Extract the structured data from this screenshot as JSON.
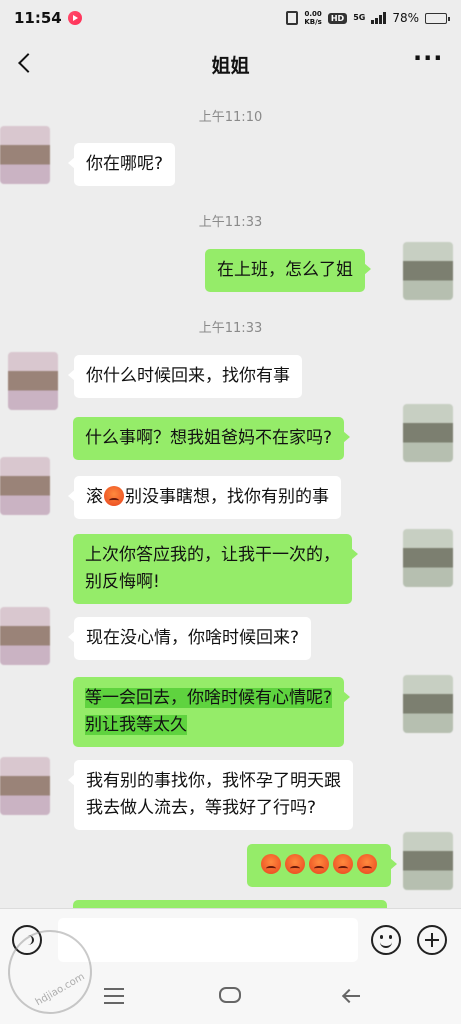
{
  "status_bar": {
    "time": "11:54",
    "net_speed_value": "0.00",
    "net_speed_unit": "KB/s",
    "hd_label": "HD",
    "network_type": "5G",
    "battery_percent": "78%",
    "battery_level": 0.78
  },
  "header": {
    "title": "姐姐"
  },
  "messages": [
    {
      "type": "time",
      "text": "上午11:10"
    },
    {
      "type": "in",
      "text": "你在哪呢?"
    },
    {
      "type": "time",
      "text": "上午11:33"
    },
    {
      "type": "out",
      "text": "在上班，怎么了姐"
    },
    {
      "type": "time",
      "text": "上午11:33"
    },
    {
      "type": "in",
      "text": "你什么时候回来，找你有事"
    },
    {
      "type": "out",
      "text": "什么事啊？想我姐爸妈不在家吗?"
    },
    {
      "type": "in",
      "text_before": "滚",
      "emoji": "angry-face-emoji",
      "text_after": "别没事瞎想，找你有别的事"
    },
    {
      "type": "out",
      "line1": "上次你答应我的，让我干一次的，",
      "line2": "别反悔啊!"
    },
    {
      "type": "in",
      "text": "现在没心情，你啥时候回来?"
    },
    {
      "type": "out",
      "line1": "等一会回去，你啥时候有心情呢?",
      "line2": "别让我等太久"
    },
    {
      "type": "in",
      "line1": "我有别的事找你，我怀孕了明天跟",
      "line2": "我去做人流去，等我好了行吗?"
    },
    {
      "type": "out",
      "emoji_count": 5,
      "emoji": "angry-face-emoji"
    }
  ],
  "input": {
    "placeholder": ""
  },
  "watermark": {
    "text": "hdjiao.com"
  },
  "colors": {
    "background": "#ededed",
    "incoming_bubble": "#ffffff",
    "outgoing_bubble": "#95ec69",
    "timestamp": "#8a8a8a"
  }
}
